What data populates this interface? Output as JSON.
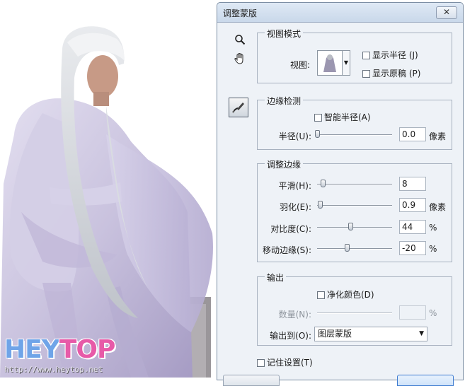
{
  "dialog": {
    "title": "调整蒙版",
    "close_glyph": "✕"
  },
  "tools": {
    "zoom": "zoom-icon",
    "hand": "hand-icon",
    "refine_radius": "refine-radius-brush-icon"
  },
  "view_mode": {
    "legend": "视图模式",
    "view_label": "视图:",
    "show_radius_label": "显示半径 (J)",
    "show_radius_checked": false,
    "show_original_label": "显示原稿 (P)",
    "show_original_checked": false
  },
  "edge_detection": {
    "legend": "边缘检测",
    "smart_radius_label": "智能半径(A)",
    "smart_radius_checked": false,
    "radius_label": "半径(U):",
    "radius_value": "0.0",
    "radius_unit": "像素",
    "radius_slider": 0.0
  },
  "adjust_edge": {
    "legend": "调整边缘",
    "rows": [
      {
        "label": "平滑(H):",
        "value": "8",
        "unit": "",
        "slider": 0.08
      },
      {
        "label": "羽化(E):",
        "value": "0.9",
        "unit": "像素",
        "slider": 0.04
      },
      {
        "label": "对比度(C):",
        "value": "44",
        "unit": "%",
        "slider": 0.44
      },
      {
        "label": "移动边缘(S):",
        "value": "-20",
        "unit": "%",
        "slider": 0.4
      }
    ]
  },
  "output": {
    "legend": "输出",
    "decontaminate_label": "净化颜色(D)",
    "decontaminate_checked": false,
    "amount_label": "数量(N):",
    "amount_value": "",
    "amount_unit": "%",
    "output_to_label": "输出到(O):",
    "output_to_value": "图层蒙版"
  },
  "remember_label": "记住设置(T)",
  "remember_checked": false,
  "watermark": {
    "logo_a": "HEY",
    "logo_b": "TOP",
    "url": "http://www.heytop.net"
  },
  "colors": {
    "dialog_bg": "#eef2f7",
    "titlebar": "#c9d8ea",
    "logo_blue": "#6fa4e8",
    "logo_pink": "#e75aa8"
  }
}
